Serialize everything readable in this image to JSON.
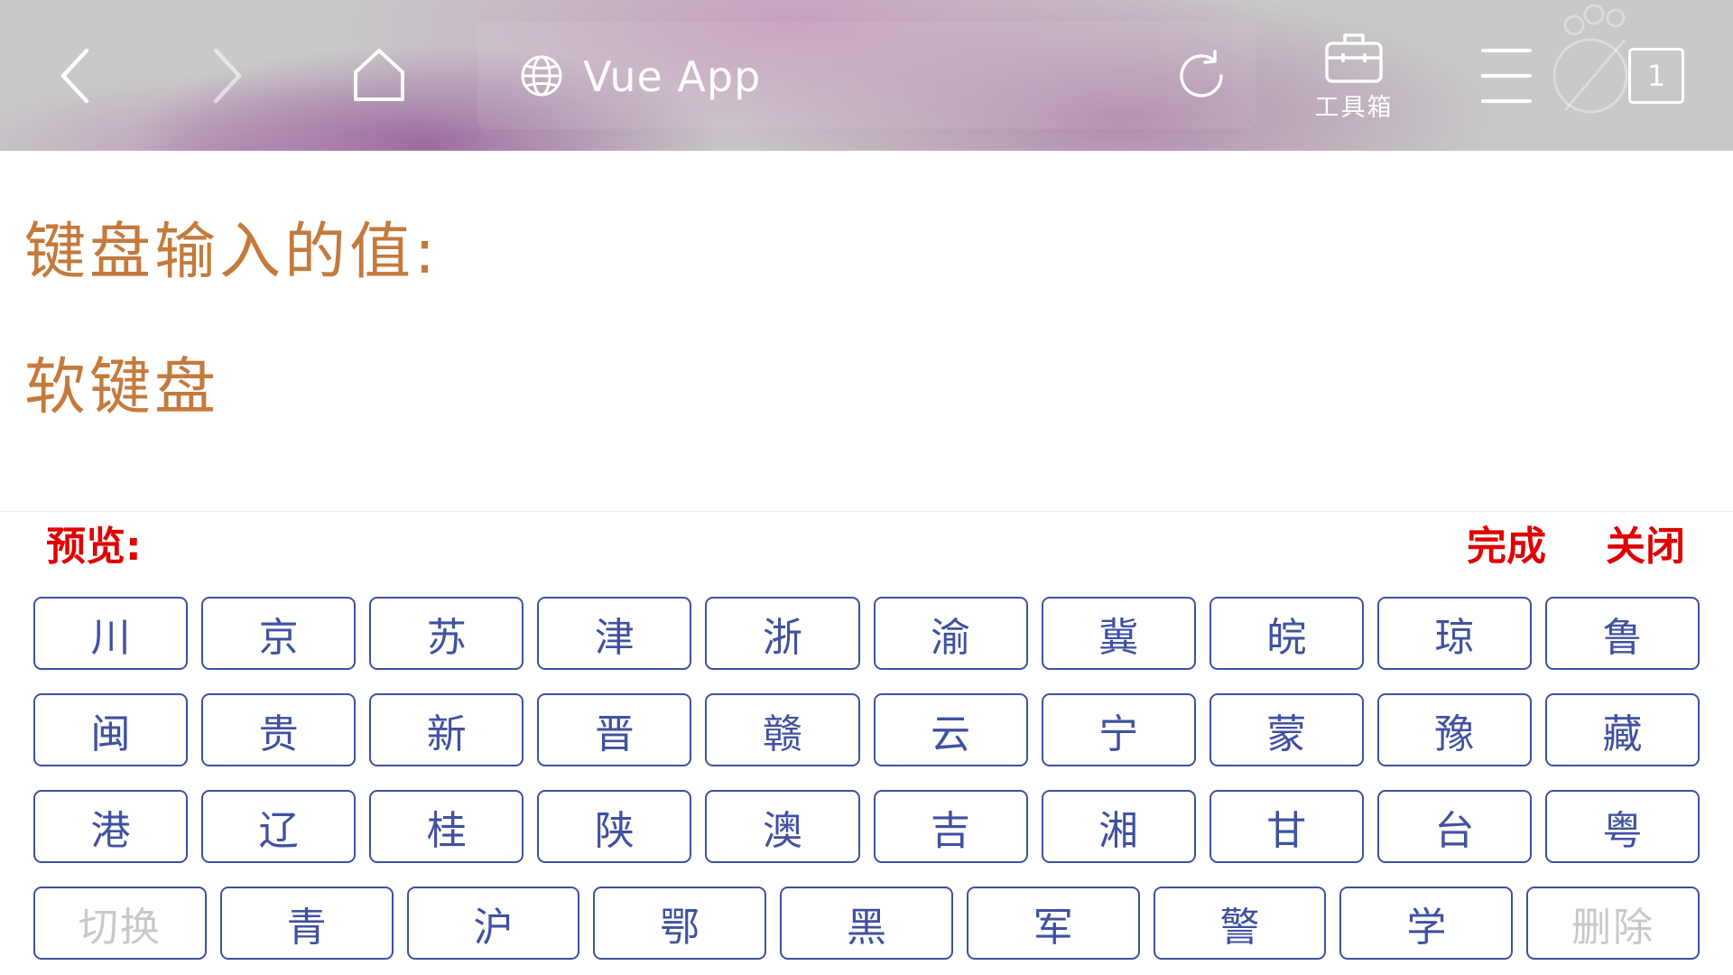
{
  "browser": {
    "page_title": "Vue App",
    "toolbox_label": "工具箱",
    "tab_count": "1",
    "icons": {
      "back": "chevron-left-icon",
      "forward": "chevron-right-icon",
      "home": "home-icon",
      "site": "globe-icon",
      "reload": "reload-icon",
      "toolbox": "toolbox-icon",
      "menu": "hamburger-menu-icon",
      "tabs": "tab-count-icon"
    }
  },
  "page": {
    "value_label": "键盘输入的值:",
    "heading": "软键盘"
  },
  "keyboard": {
    "preview_label": "预览:",
    "done_label": "完成",
    "close_label": "关闭",
    "rows": [
      [
        "川",
        "京",
        "苏",
        "津",
        "浙",
        "渝",
        "冀",
        "皖",
        "琼",
        "鲁"
      ],
      [
        "闽",
        "贵",
        "新",
        "晋",
        "赣",
        "云",
        "宁",
        "蒙",
        "豫",
        "藏"
      ],
      [
        "港",
        "辽",
        "桂",
        "陕",
        "澳",
        "吉",
        "湘",
        "甘",
        "台",
        "粤"
      ],
      [
        "切换",
        "青",
        "沪",
        "鄂",
        "黑",
        "军",
        "警",
        "学",
        "删除"
      ]
    ]
  },
  "colors": {
    "title": "#c47a3c",
    "action": "#e00000",
    "key": "#3f51a0",
    "key_muted": "#c8c8c8",
    "toolbar_base": "#c9c9c9",
    "toolbar_accent": "#a878a6"
  }
}
